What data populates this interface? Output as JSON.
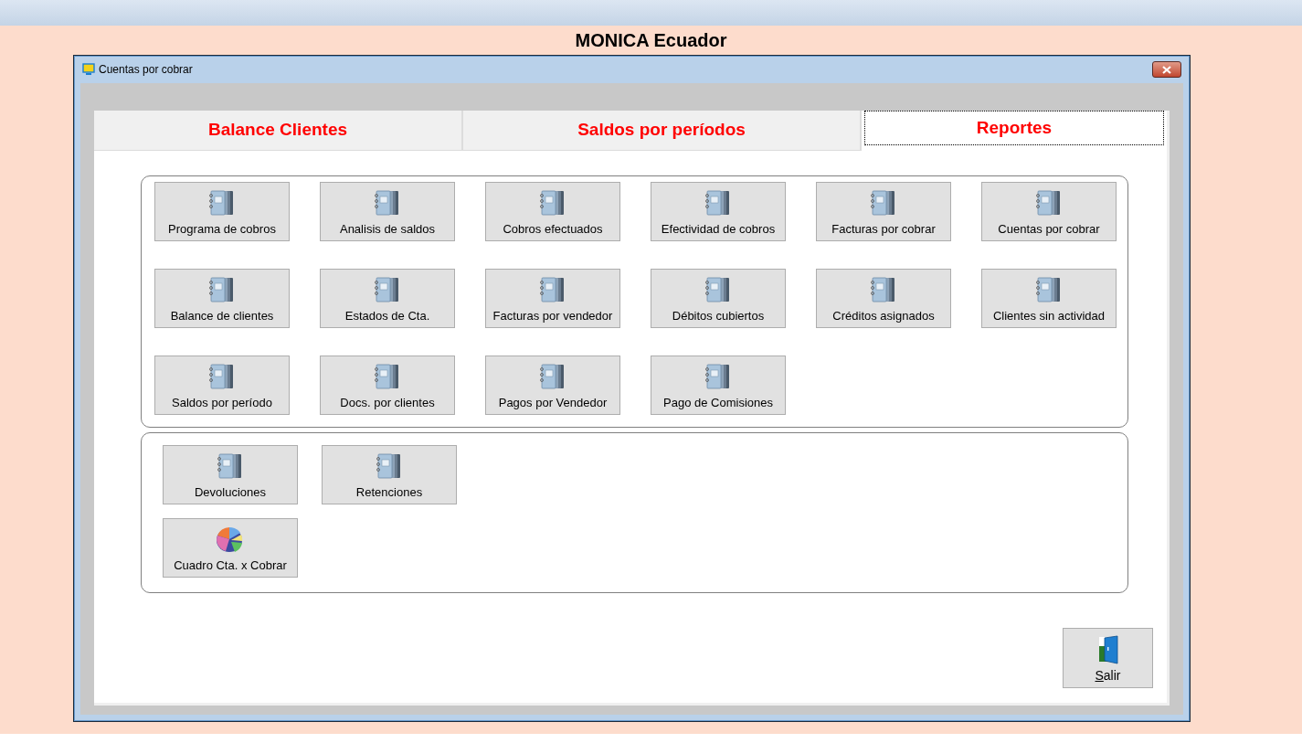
{
  "app_title": "MONICA Ecuador",
  "window": {
    "title": "Cuentas por cobrar"
  },
  "tabs": [
    {
      "label": "Balance Clientes",
      "selected": false
    },
    {
      "label": "Saldos por períodos",
      "selected": false
    },
    {
      "label": "Reportes",
      "selected": true
    }
  ],
  "report_groups": [
    {
      "items": [
        {
          "label": "Programa de cobros",
          "kind": "notebook"
        },
        {
          "label": "Analisis de saldos",
          "kind": "notebook"
        },
        {
          "label": "Cobros efectuados",
          "kind": "notebook"
        },
        {
          "label": "Efectividad de cobros",
          "kind": "notebook"
        },
        {
          "label": "Facturas por cobrar",
          "kind": "notebook"
        },
        {
          "label": "Cuentas por cobrar",
          "kind": "notebook"
        },
        {
          "label": "Balance de clientes",
          "kind": "notebook"
        },
        {
          "label": "Estados de Cta.",
          "kind": "notebook"
        },
        {
          "label": "Facturas por vendedor",
          "kind": "notebook"
        },
        {
          "label": "Débitos cubiertos",
          "kind": "notebook"
        },
        {
          "label": "Créditos asignados",
          "kind": "notebook"
        },
        {
          "label": "Clientes sin actividad",
          "kind": "notebook"
        },
        {
          "label": "Saldos por período",
          "kind": "notebook"
        },
        {
          "label": "Docs. por clientes",
          "kind": "notebook"
        },
        {
          "label": "Pagos por Vendedor",
          "kind": "notebook"
        },
        {
          "label": "Pago de Comisiones",
          "kind": "notebook"
        }
      ]
    },
    {
      "items": [
        {
          "label": "Devoluciones",
          "kind": "notebook"
        },
        {
          "label": "Retenciones",
          "kind": "notebook"
        },
        {
          "label": "Cuadro Cta. x Cobrar",
          "kind": "pie"
        }
      ]
    }
  ],
  "exit_button": {
    "label": "Salir",
    "mnemonic_underlined": true
  }
}
